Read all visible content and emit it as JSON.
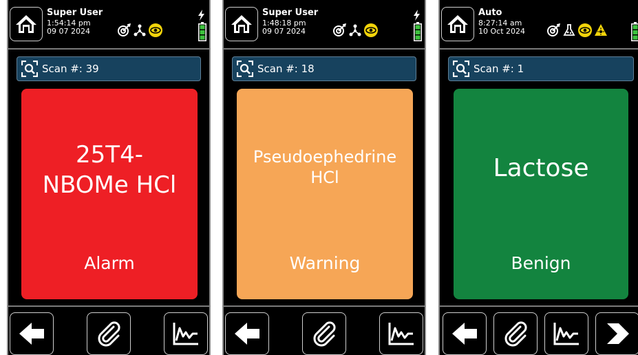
{
  "colors": {
    "alarm": "#ee1f25",
    "warning": "#f6a656",
    "benign": "#13843f",
    "scan_bar": "#17425e"
  },
  "screens": [
    {
      "user": "Super User",
      "time": "1:54:14 pm",
      "date": "09 07 2024",
      "status_icons": [
        "target-icon",
        "molecule-icon",
        "eye-icon"
      ],
      "scan_label": "Scan #: 39",
      "compound": "25T4-\nNBOMe HCl",
      "level": "Alarm",
      "nav": [
        "back-arrow-icon",
        "paperclip-icon",
        "spectrum-chart-icon"
      ]
    },
    {
      "user": "Super User",
      "time": "1:48:18 pm",
      "date": "09 07 2024",
      "status_icons": [
        "target-icon",
        "molecule-icon",
        "eye-icon"
      ],
      "scan_label": "Scan #: 18",
      "compound": "Pseudoephedrine\nHCl",
      "level": "Warning",
      "nav": [
        "back-arrow-icon",
        "paperclip-icon",
        "spectrum-chart-icon"
      ]
    },
    {
      "user": "Auto",
      "time": "8:27:14 am",
      "date": "10 Oct 2024",
      "status_icons": [
        "target-icon",
        "flask-icon",
        "eye-icon",
        "laser-warning-icon"
      ],
      "scan_label": "Scan #: 1",
      "compound": "Lactose",
      "level": "Benign",
      "nav": [
        "back-arrow-icon",
        "paperclip-icon",
        "spectrum-chart-icon",
        "forward-chevron-icon"
      ]
    }
  ]
}
